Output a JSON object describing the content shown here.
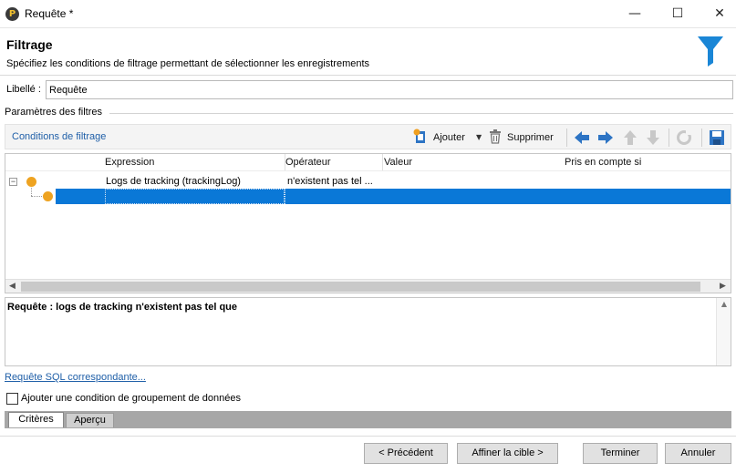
{
  "window": {
    "title": "Requête *",
    "app_icon_letter": "P",
    "minimize_glyph": "—",
    "maximize_glyph": "☐",
    "close_glyph": "✕"
  },
  "header": {
    "title": "Filtrage",
    "subtitle": "Spécifiez les conditions de filtrage permettant de sélectionner les enregistrements",
    "icon": "filter-icon"
  },
  "label_field": {
    "label": "Libellé :",
    "value": "Requête"
  },
  "params": {
    "group_label": "Paramètres des filtres"
  },
  "toolbar": {
    "title": "Conditions de filtrage",
    "add_label": "Ajouter",
    "add_caret": "▼",
    "delete_label": "Supprimer",
    "icons": [
      "add-icon",
      "delete-icon",
      "arrow-left-icon",
      "arrow-right-icon",
      "arrow-up-icon",
      "arrow-down-icon",
      "refresh-icon",
      "save-icon"
    ]
  },
  "grid": {
    "columns": [
      "Expression",
      "Opérateur",
      "Valeur",
      "Pris en compte si"
    ],
    "tree_toggle": "−",
    "rows": [
      {
        "expression": "Logs de tracking (trackingLog)",
        "operator": "n'existent pas tel ...",
        "value": "",
        "condition": ""
      },
      {
        "expression": "",
        "operator": "",
        "value": "",
        "condition": "",
        "selected": true
      }
    ],
    "scroll_left": "◀",
    "scroll_right": "▶"
  },
  "description": {
    "text": "Requête : logs de tracking n'existent pas tel que",
    "scroll_up": "▲"
  },
  "sql_link": "Requête SQL correspondante...",
  "group_condition": {
    "label": "Ajouter une condition de groupement de données",
    "checked": false
  },
  "tabs": [
    {
      "label": "Critères",
      "active": true
    },
    {
      "label": "Aperçu",
      "active": false
    }
  ],
  "buttons": {
    "previous": "< Précédent",
    "refine": "Affiner la cible >",
    "finish": "Terminer",
    "cancel": "Annuler"
  },
  "colors": {
    "accent_blue": "#1f5fa8",
    "selection": "#0a78d7",
    "node_orange": "#eea321",
    "funnel_blue": "#1a86d6"
  }
}
